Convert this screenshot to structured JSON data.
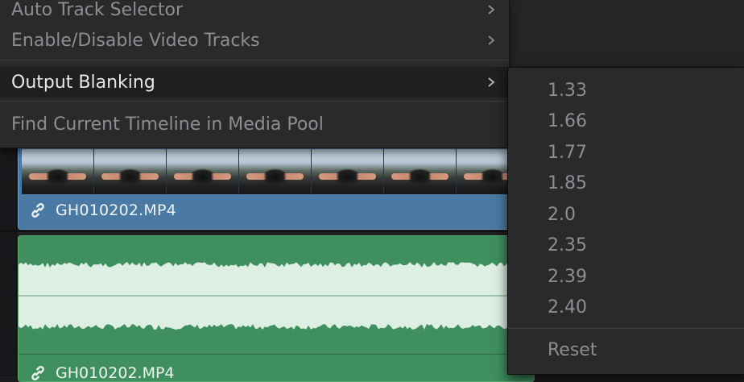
{
  "menu": {
    "items": [
      {
        "label": "Auto Track Selector",
        "has_submenu": true
      },
      {
        "label": "Enable/Disable Video Tracks",
        "has_submenu": true
      },
      {
        "label": "Output Blanking",
        "has_submenu": true,
        "active": true
      },
      {
        "label": "Find Current Timeline in Media Pool",
        "has_submenu": false
      }
    ]
  },
  "submenu": {
    "items": [
      "1.33",
      "1.66",
      "1.77",
      "1.85",
      "2.0",
      "2.35",
      "2.39",
      "2.40"
    ],
    "reset_label": "Reset"
  },
  "timeline": {
    "video_clip": {
      "name": "GH010202.MP4",
      "link_icon": "link-icon",
      "color": "#4a7aa3"
    },
    "audio_clip": {
      "name": "GH010202.MP4",
      "link_icon": "link-icon",
      "color": "#3f8f5f"
    }
  }
}
